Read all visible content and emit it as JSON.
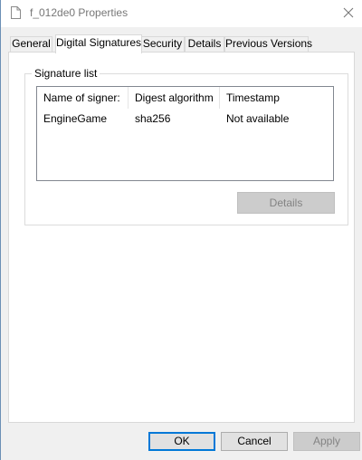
{
  "window": {
    "title": "f_012de0 Properties"
  },
  "tabs": [
    {
      "label": "General",
      "active": false
    },
    {
      "label": "Digital Signatures",
      "active": true
    },
    {
      "label": "Security",
      "active": false
    },
    {
      "label": "Details",
      "active": false
    },
    {
      "label": "Previous Versions",
      "active": false
    }
  ],
  "signature_list": {
    "label": "Signature list",
    "columns": [
      "Name of signer:",
      "Digest algorithm",
      "Timestamp"
    ],
    "rows": [
      [
        "EngineGame",
        "sha256",
        "Not available"
      ]
    ],
    "details_label": "Details",
    "details_enabled": false
  },
  "footer": {
    "ok_label": "OK",
    "cancel_label": "Cancel",
    "apply_label": "Apply",
    "apply_enabled": false
  },
  "icons": {
    "title": "document-icon",
    "close": "close-icon"
  }
}
